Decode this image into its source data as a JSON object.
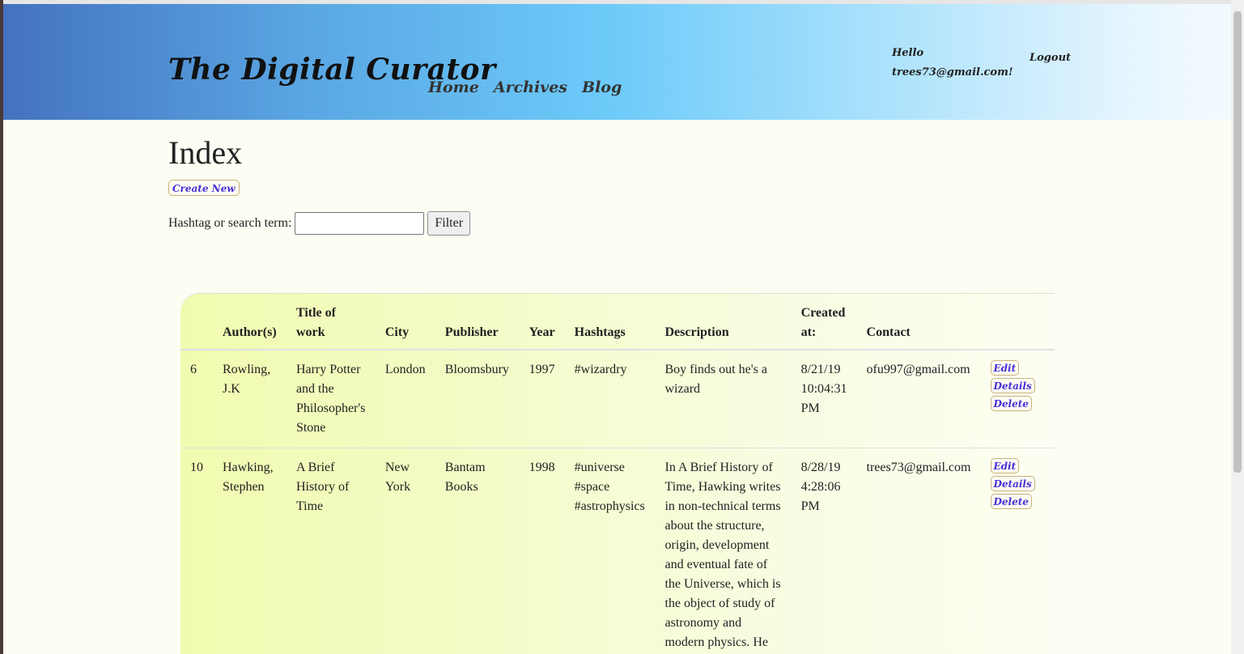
{
  "header": {
    "brand": "The Digital Curator",
    "nav": [
      "Home",
      "Archives",
      "Blog"
    ],
    "greeting": "Hello trees73@gmail.com!",
    "logout": "Logout"
  },
  "main": {
    "title": "Index",
    "create_label": "Create New",
    "filter_label": "Hashtag or search term:",
    "filter_value": "",
    "filter_button": "Filter"
  },
  "table": {
    "columns": [
      "",
      "Author(s)",
      "Title of work",
      "City",
      "Publisher",
      "Year",
      "Hashtags",
      "Description",
      "Created at:",
      "Contact",
      ""
    ],
    "rows": [
      {
        "id": "6",
        "author": "Rowling, J.K",
        "title": "Harry Potter and the Philosopher's Stone",
        "city": "London",
        "publisher": "Bloomsbury",
        "year": "1997",
        "hashtags": "#wizardry",
        "description": "Boy finds out he's a wizard",
        "created": "8/21/19 10:04:31 PM",
        "contact": "ofu997@gmail.com",
        "actions": [
          "Edit",
          "Details",
          "Delete"
        ]
      },
      {
        "id": "10",
        "author": "Hawking, Stephen",
        "title": "A Brief History of Time",
        "city": "New York",
        "publisher": "Bantam Books",
        "year": "1998",
        "hashtags": "#universe #space #astrophysics",
        "description": "In A Brief History of Time, Hawking writes in non-technical terms about the structure, origin, development and eventual fate of the Universe, which is the object of study of astronomy and modern physics. He talks about",
        "created": "8/28/19 4:28:06 PM",
        "contact": "trees73@gmail.com",
        "actions": [
          "Edit",
          "Details",
          "Delete"
        ]
      }
    ]
  }
}
